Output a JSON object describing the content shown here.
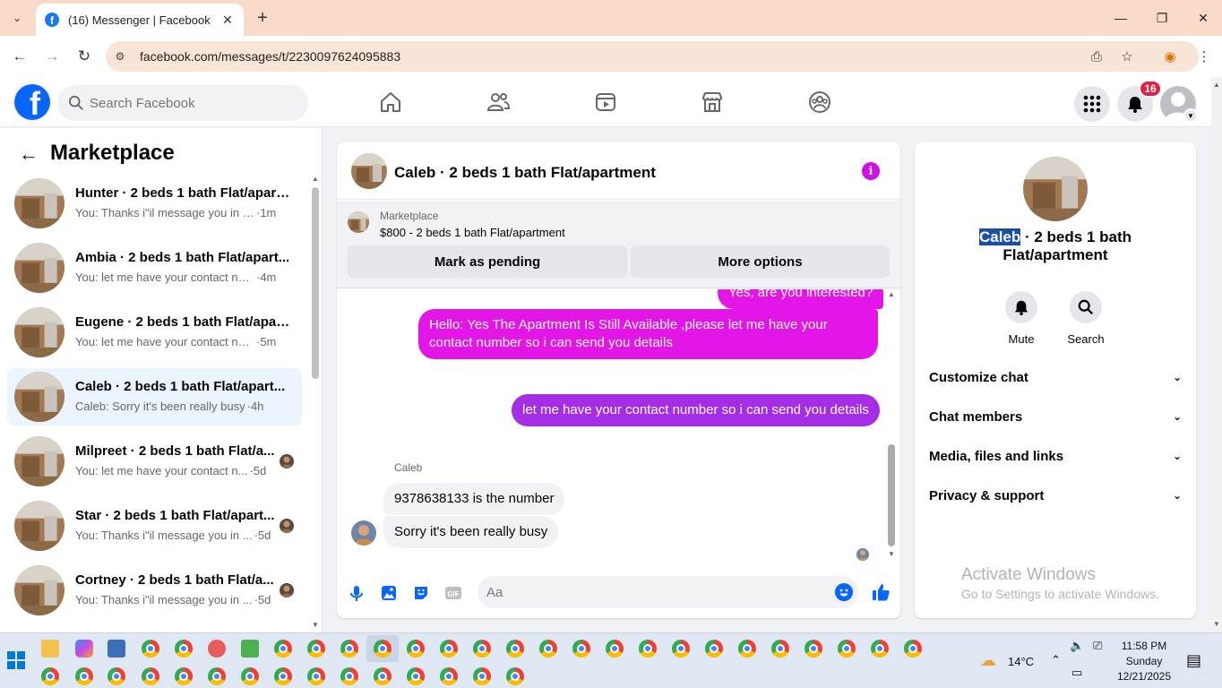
{
  "browser": {
    "tab_title": "(16) Messenger | Facebook",
    "url": "facebook.com/messages/t/2230097624095883"
  },
  "fb": {
    "search_placeholder": "Search Facebook",
    "notification_count": "16",
    "brand_color": "#0866ff"
  },
  "left": {
    "title": "Marketplace",
    "conversations": [
      {
        "title": "Hunter · 2 beds 1 bath Flat/apart...",
        "snippet": "You: Thanks i\"il message you in a ...",
        "time": "·1m",
        "active": false
      },
      {
        "title": "Ambia · 2 beds 1 bath Flat/apart...",
        "snippet": "You: let me have your contact num...",
        "time": "·4m",
        "active": false
      },
      {
        "title": "Eugene · 2 beds 1 bath Flat/apar...",
        "snippet": "You: let me have your contact num...",
        "time": "·5m",
        "active": false
      },
      {
        "title": "Caleb · 2 beds 1 bath Flat/apart...",
        "snippet": "Caleb: Sorry it's been really busy",
        "time": "·4h",
        "active": true
      },
      {
        "title": "Milpreet · 2 beds 1 bath Flat/a...",
        "snippet": "You: let me have your contact n...",
        "time": "·5d",
        "active": false
      },
      {
        "title": "Star · 2 beds 1 bath Flat/apart...",
        "snippet": "You: Thanks i\"il message you in ...",
        "time": "·5d",
        "active": false
      },
      {
        "title": "Cortney · 2 beds 1 bath Flat/a...",
        "snippet": "You: Thanks i\"il message you in ...",
        "time": "·5d",
        "active": false
      }
    ]
  },
  "chat": {
    "title": "Caleb · 2 beds 1 bath Flat/apartment",
    "marketplace_label": "Marketplace",
    "listing": "$800 - 2 beds 1 bath Flat/apartment",
    "mark_pending": "Mark as pending",
    "more_options": "More options",
    "messages": [
      {
        "from": "me",
        "text": "Yes, are you interested?"
      },
      {
        "from": "me",
        "text": "Hello: Yes The Apartment Is Still Available ,please let me have your contact number so i can send you details"
      },
      {
        "from": "me",
        "text": "let me have your contact number so i can send you details"
      },
      {
        "from": "them",
        "text": "9378638133 is the number"
      },
      {
        "from": "them",
        "text": "Sorry it's been really busy"
      }
    ],
    "sender_name": "Caleb",
    "composer_placeholder": "Aa",
    "accent_pink": "#e316e7",
    "accent_purple": "#a62de6"
  },
  "right": {
    "name_selected": "Caleb",
    "name_rest": " · 2 beds 1 bath Flat/apartment",
    "mute": "Mute",
    "search": "Search",
    "rows": [
      "Customize chat",
      "Chat members",
      "Media, files and links",
      "Privacy & support"
    ]
  },
  "watermark": {
    "line1": "Activate Windows",
    "line2": "Go to Settings to activate Windows."
  },
  "taskbar": {
    "temperature": "14°C",
    "time": "11:58 PM",
    "day": "Sunday",
    "date": "12/21/2025"
  }
}
